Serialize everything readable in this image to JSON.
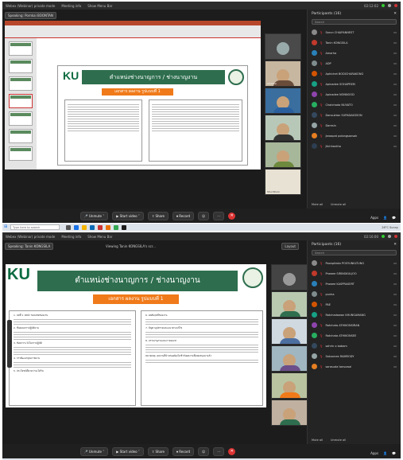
{
  "shot1": {
    "title_left": "Webex (Webinar) private mode",
    "title_tabs": [
      "Meeting info",
      "Show Menu Bar"
    ],
    "title_time": "02:12:02",
    "speaking": "Speaking: Pornkai BOONTAN",
    "slide": {
      "logo": "KU",
      "title": "ตำแหน่งช่างนาญการ / ช่างนาญงาน",
      "subtitle": "เอกสาร ผลงาน รูปแบบที่ 1"
    },
    "video_names": [
      "Amarha",
      "",
      "",
      "",
      "Shui Shuin"
    ],
    "participants_header": "Participants (16)",
    "search_placeholder": "Search",
    "participants": [
      "Sarun CHAIPANNEST",
      "Tanin KONGSILA",
      "Amarha",
      "ADP",
      "Aphichet BODICHARAKONG",
      "Apinadee SOHAPREM",
      "Apinadee NONNOOD",
      "Chotchada NUVATO",
      "Dansuktan SUPADAKSSON",
      "Daresin",
      "Jaroopat polongsansak",
      "Jilchhantha"
    ],
    "mute_all": "Mute all",
    "unmute_all": "Unmute all",
    "controls": [
      "Unmute",
      "Start video",
      "Share",
      "Record"
    ],
    "apps": "Apps"
  },
  "taskbar1": {
    "search": "Type here to search",
    "tray": "28°C Sunny"
  },
  "shot2": {
    "title_left": "Webex (Webinar) private mode",
    "title_tabs": [
      "Meeting info",
      "Show Menu Bar"
    ],
    "title_time": "02:16:00",
    "speaking": "Speaking: Tanin KONGSILA",
    "viewing": "Viewing Tanin KONGSILA's scr...",
    "layout": "Layout",
    "slide": {
      "logo": "KU",
      "title": "ตำแหน่งช่างนาญการ / ช่างนาญงาน",
      "subtitle": "เอกสาร ผลงาน รูปแบบที่ 1",
      "left_items": [
        "1. บทที่ 1 บทนำ ขอบเขตของงาน",
        "2. ขั้นตอนการปฏิบัติงาน",
        "3. ข้อควรระวังในการปฏิบัติ",
        "4. การพัฒนาคุณภาพงาน",
        "5. ประโยชน์ที่คาดว่าจะได้รับ"
      ],
      "right_items": [
        "6. ผลสัมฤทธิ์ของงาน",
        "7. ปัญหาอุปสรรคและแนวทางแก้ไข",
        "8. บรรณานุกรมและภาคผนวก",
        "หมายเหตุ: ผลงานที่นำเสนอต้องไม่ซ้ำกับผลงานที่เคยเสนอมาแล้ว"
      ]
    },
    "participants_header": "Participants (16)",
    "search_placeholder": "Search",
    "participants": [
      "Poonpitaka POSYUNKLTUNG",
      "Prawee SIRINGKULJOO",
      "Prawee KASPRASERT",
      "punha",
      "PAE",
      "Ratchadawan KHUNSAMANG",
      "Ratchata ATHIKONSIRAN",
      "Ratchata ATHIKONSEE",
      "sahrin o babam",
      "Sakunnee RAMRODY",
      "sarasuda tansuwai"
    ],
    "mute_all": "Mute all",
    "unmute_all": "Unmute all",
    "controls": [
      "Unmute",
      "Start video",
      "Share",
      "Record"
    ],
    "apps": "Apps"
  }
}
